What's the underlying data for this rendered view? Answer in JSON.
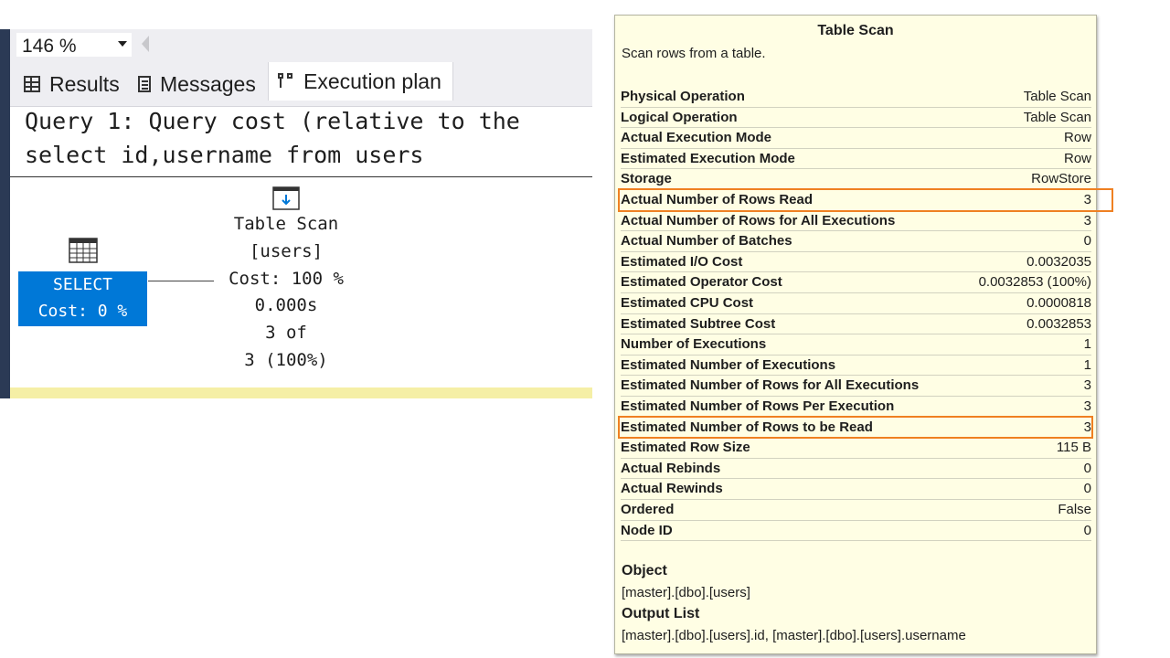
{
  "toolbar": {
    "zoom": "146 %"
  },
  "tabs": [
    {
      "label": "Results",
      "icon": "grid-icon"
    },
    {
      "label": "Messages",
      "icon": "messages-icon"
    },
    {
      "label": "Execution plan",
      "icon": "execution-plan-icon"
    }
  ],
  "query": {
    "header": "Query 1: Query cost (relative to the",
    "sql": "select id,username from users"
  },
  "plan": {
    "select_node": {
      "label": "SELECT",
      "cost": "Cost: 0 %"
    },
    "scan_node": {
      "name": "Table Scan",
      "object": "[users]",
      "cost": "Cost: 100 %",
      "time": "0.000s",
      "rows_line1": "3 of",
      "rows_line2": "3 (100%)"
    }
  },
  "tooltip": {
    "title": "Table Scan",
    "description": "Scan rows from a table.",
    "properties": [
      {
        "name": "Physical Operation",
        "value": "Table Scan"
      },
      {
        "name": "Logical Operation",
        "value": "Table Scan"
      },
      {
        "name": "Actual Execution Mode",
        "value": "Row"
      },
      {
        "name": "Estimated Execution Mode",
        "value": "Row"
      },
      {
        "name": "Storage",
        "value": "RowStore"
      },
      {
        "name": "Actual Number of Rows Read",
        "value": "3",
        "highlighted": true
      },
      {
        "name": "Actual Number of Rows for All Executions",
        "value": "3"
      },
      {
        "name": "Actual Number of Batches",
        "value": "0"
      },
      {
        "name": "Estimated I/O Cost",
        "value": "0.0032035"
      },
      {
        "name": "Estimated Operator Cost",
        "value": "0.0032853 (100%)"
      },
      {
        "name": "Estimated CPU Cost",
        "value": "0.0000818"
      },
      {
        "name": "Estimated Subtree Cost",
        "value": "0.0032853"
      },
      {
        "name": "Number of Executions",
        "value": "1"
      },
      {
        "name": "Estimated Number of Executions",
        "value": "1"
      },
      {
        "name": "Estimated Number of Rows for All Executions",
        "value": "3"
      },
      {
        "name": "Estimated Number of Rows Per Execution",
        "value": "3"
      },
      {
        "name": "Estimated Number of Rows to be Read",
        "value": "3",
        "highlighted": true
      },
      {
        "name": "Estimated Row Size",
        "value": "115 B"
      },
      {
        "name": "Actual Rebinds",
        "value": "0"
      },
      {
        "name": "Actual Rewinds",
        "value": "0"
      },
      {
        "name": "Ordered",
        "value": "False"
      },
      {
        "name": "Node ID",
        "value": "0"
      }
    ],
    "object_title": "Object",
    "object_value": "[master].[dbo].[users]",
    "output_title": "Output List",
    "output_value": "[master].[dbo].[users].id, [master].[dbo].[users].username"
  },
  "colors": {
    "select_node_bg": "#0078d7",
    "tooltip_bg": "#fffee4",
    "highlight": "#ef8022",
    "status_bar": "#f5efa6"
  }
}
